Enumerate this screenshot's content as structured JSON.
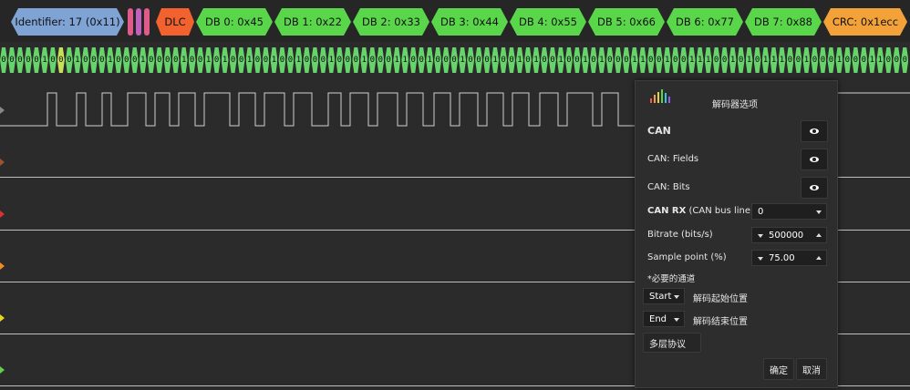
{
  "fields": {
    "identifier": "Identifier: 17 (0x11)",
    "dlc": "DLC",
    "db": [
      "DB 0: 0x45",
      "DB 1: 0x22",
      "DB 2: 0x33",
      "DB 3: 0x44",
      "DB 4: 0x55",
      "DB 5: 0x66",
      "DB 6: 0x77",
      "DB 7: 0x88"
    ],
    "crc": "CRC: 0x1ecc"
  },
  "bits": "0000010001000100010000100101001001001000100010001100100010001001010010010100011001001110010101110010001000110001111100",
  "panel": {
    "title": "解码器选项",
    "decoder": "CAN",
    "fields_label": "CAN: Fields",
    "bits_label": "CAN: Bits",
    "can_rx_bold": "CAN RX",
    "can_rx_rest": " (CAN bus line) *",
    "can_rx_value": "0",
    "bitrate_label": "Bitrate (bits/s)",
    "bitrate_value": "500000",
    "sample_label": "Sample point (%)",
    "sample_value": "75.00",
    "required_note": "*必要的通道",
    "start_value": "Start",
    "start_label": "解码起始位置",
    "end_value": "End",
    "end_label": "解码结束位置",
    "multi_layer": "多层协议",
    "ok": "确定",
    "cancel": "取消"
  },
  "colors": {
    "identifier": "#7fa3d4",
    "dlc": "#f2622e",
    "db": "#5ad64a",
    "crc": "#f3a23a",
    "bits": "#66d46a"
  }
}
